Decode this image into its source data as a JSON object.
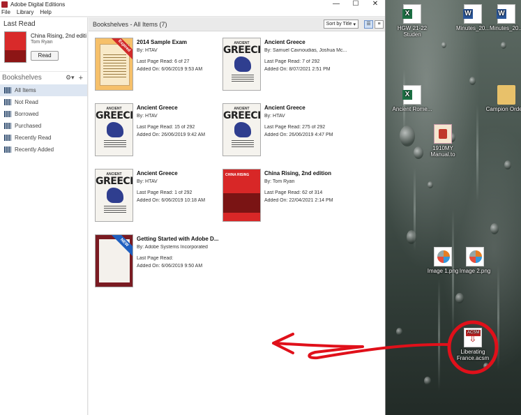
{
  "window": {
    "title": "Adobe Digital Editions",
    "controls": {
      "minimize": "—",
      "maximize": "☐",
      "close": "✕"
    }
  },
  "menu": [
    "File",
    "Library",
    "Help"
  ],
  "last_read": {
    "heading": "Last Read",
    "title": "China Rising, 2nd editi...",
    "author": "Tom Ryan",
    "button": "Read"
  },
  "bookshelves": {
    "heading": "Bookshelves",
    "items": [
      "All Items",
      "Not Read",
      "Borrowed",
      "Purchased",
      "Recently Read",
      "Recently Added"
    ],
    "selected": "All Items"
  },
  "main": {
    "title": "Bookshelves - All Items (7)",
    "sort_label": "Sort by Title",
    "books": [
      {
        "title": "2014 Sample Exam",
        "by": "By:  HTAV",
        "last": "Last Page Read:  6 of 27",
        "added": "Added On:  6/06/2019 9:53 AM",
        "cover": "exam",
        "ribbon": "Expired",
        "ribbon_color": "red"
      },
      {
        "title": "Ancient Greece",
        "by": "By:  Samuel Cavnoudias, Joshua Mc...",
        "last": "Last Page Read:  7 of 292",
        "added": "Added On:  8/07/2021 2:51 PM",
        "cover": "greece",
        "ribbon": "",
        "ribbon_color": ""
      },
      {
        "title": "Ancient Greece",
        "by": "By:  HTAV",
        "last": "Last Page Read:  15 of 292",
        "added": "Added On:  26/06/2019 9:42 AM",
        "cover": "greece",
        "ribbon": "",
        "ribbon_color": ""
      },
      {
        "title": "Ancient Greece",
        "by": "By:  HTAV",
        "last": "Last Page Read:  275 of 292",
        "added": "Added On:  26/06/2019 4:47 PM",
        "cover": "greece",
        "ribbon": "",
        "ribbon_color": ""
      },
      {
        "title": "Ancient Greece",
        "by": "By:  HTAV",
        "last": "Last Page Read:  1 of 292",
        "added": "Added On:  6/06/2019 10:18 AM",
        "cover": "greece",
        "ribbon": "",
        "ribbon_color": ""
      },
      {
        "title": "China Rising, 2nd edition",
        "by": "By:  Tom Ryan",
        "last": "Last Page Read:  62 of 314",
        "added": "Added On:  22/04/2021 2:14 PM",
        "cover": "china",
        "ribbon": "",
        "ribbon_color": ""
      },
      {
        "title": "Getting Started with Adobe D...",
        "by": "By:  Adobe Systems Incorporated",
        "last": "Last Page Read:",
        "added": "Added On:  6/06/2019 9:50 AM",
        "cover": "adobe",
        "ribbon": "NEW",
        "ribbon_color": "blue"
      }
    ],
    "greece_cover": {
      "sub": "ANCIENT",
      "main": "GREECE"
    },
    "china_cover_text": "CHINA RISING"
  },
  "desktop": {
    "icons": [
      {
        "label": "HGW 21-22 Studen",
        "kind": "xls"
      },
      {
        "label": "Minutes_20...",
        "kind": "doc"
      },
      {
        "label": "Minutes_20...",
        "kind": "doc"
      },
      {
        "label": "Ancient Rome...",
        "kind": "xls"
      },
      {
        "label": "Campion Orders",
        "kind": "folder"
      },
      {
        "label": "1910MY Manual.to",
        "kind": "pdf"
      },
      {
        "label": "Image 1.png",
        "kind": "pngi"
      },
      {
        "label": "Image 2.png",
        "kind": "pngi"
      },
      {
        "label": "Liberating France.acsm",
        "kind": "acsm"
      }
    ],
    "annotation_color": "#e0101a"
  }
}
